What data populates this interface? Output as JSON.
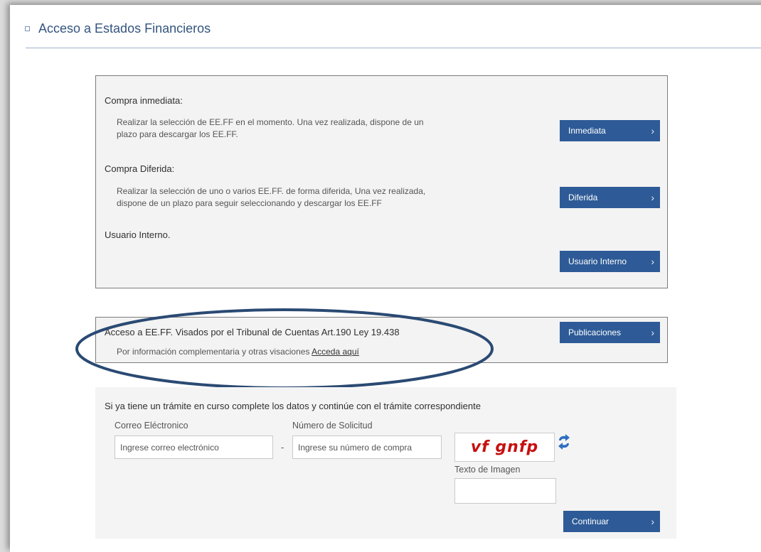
{
  "header": {
    "title": "Acceso a Estados Financieros"
  },
  "purchase": {
    "immediate": {
      "heading": "Compra inmediata:",
      "desc_line1": "Realizar la selección de EE.FF en el momento. Una vez realizada, dispone de un",
      "desc_line2": "plazo para descargar los EE.FF.",
      "button": "Inmediata"
    },
    "deferred": {
      "heading": "Compra Diferida:",
      "desc_line1": "Realizar la selección de uno o varios EE.FF. de forma diferida, Una vez realizada,",
      "desc_line2": "dispone de un plazo para seguir seleccionando y descargar los EE.FF",
      "button": "Diferida"
    },
    "internal": {
      "heading": "Usuario Interno.",
      "button": "Usuario Interno"
    }
  },
  "publications": {
    "heading": "Acceso a EE.FF. Visados por el Tribunal de Cuentas Art.190 Ley 19.438",
    "info_text": "Por información complementaria y otras visaciones",
    "link": "Acceda aquí",
    "button": "Publicaciones"
  },
  "continue_form": {
    "heading": "Si ya tiene un trámite en curso complete los datos y continúe con el trámite correspondiente",
    "email_label": "Correo Eléctronico",
    "email_placeholder": "Ingrese correo electrónico",
    "separator": "-",
    "request_label": "Número de Solicitud",
    "request_placeholder": "Ingrese su número de compra",
    "captcha_text": "vf gnfp",
    "captcha_label": "Texto de Imagen",
    "button": "Continuar"
  },
  "icons": {
    "chevron": "›",
    "refresh": "refresh-icon"
  },
  "colors": {
    "button_bg": "#2e5b97",
    "header_text": "#34547f",
    "captcha_red": "#c80f0f",
    "highlight_ellipse": "#2a4a73"
  }
}
